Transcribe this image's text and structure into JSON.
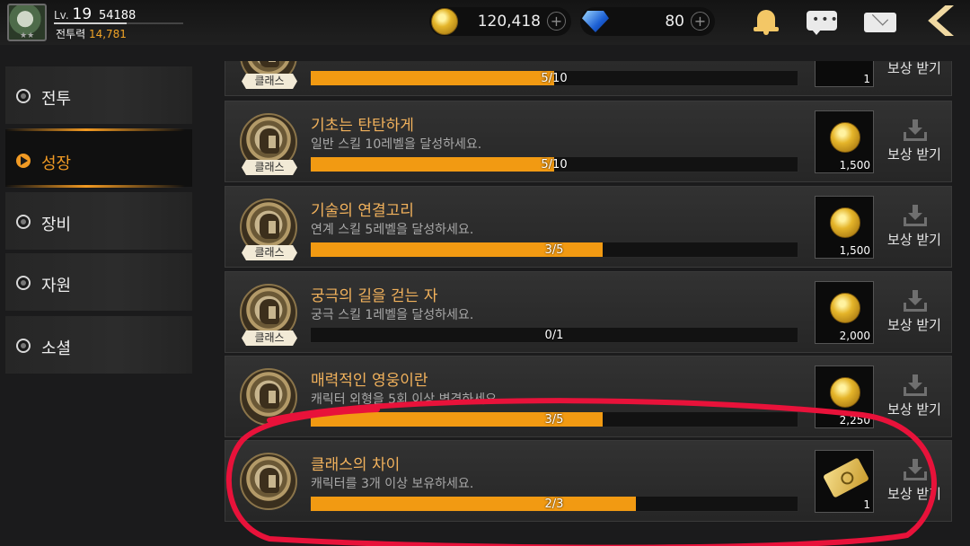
{
  "player": {
    "level_label": "Lv.",
    "level": "19",
    "exp": "54188",
    "power_label": "전투력",
    "power": "14,781",
    "stars": "★★"
  },
  "currency": {
    "gold": "120,418",
    "gems": "80",
    "plus": "+"
  },
  "top_icons": [
    "bell-icon",
    "chat-icon",
    "mail-icon",
    "back-arrow-icon"
  ],
  "sidebar": {
    "items": [
      {
        "label": "전투",
        "active": false
      },
      {
        "label": "성장",
        "active": true
      },
      {
        "label": "장비",
        "active": false
      },
      {
        "label": "자원",
        "active": false
      },
      {
        "label": "소셜",
        "active": false
      }
    ]
  },
  "quests": [
    {
      "title": "",
      "desc": "",
      "tag": "클래스",
      "progress": "5/10",
      "fraction": 0.5,
      "reward_qty": "1",
      "reward_type": "item",
      "claim": "보상 받기"
    },
    {
      "title": "기초는 탄탄하게",
      "desc": "일반 스킬 10레벨을 달성하세요.",
      "tag": "클래스",
      "progress": "5/10",
      "fraction": 0.5,
      "reward_qty": "1,500",
      "reward_type": "gold",
      "claim": "보상 받기"
    },
    {
      "title": "기술의 연결고리",
      "desc": "연계 스킬 5레벨을 달성하세요.",
      "tag": "클래스",
      "progress": "3/5",
      "fraction": 0.6,
      "reward_qty": "1,500",
      "reward_type": "gold",
      "claim": "보상 받기"
    },
    {
      "title": "궁극의 길을 걷는 자",
      "desc": "궁극 스킬 1레벨을 달성하세요.",
      "tag": "클래스",
      "progress": "0/1",
      "fraction": 0.0,
      "reward_qty": "2,000",
      "reward_type": "gold",
      "claim": "보상 받기"
    },
    {
      "title": "매력적인 영웅이란",
      "desc": "캐릭터 외형을 5회 이상 변경하세요.",
      "tag": "",
      "progress": "3/5",
      "fraction": 0.6,
      "reward_qty": "2,250",
      "reward_type": "gold",
      "claim": "보상 받기"
    },
    {
      "title": "클래스의 차이",
      "desc": "캐릭터를 3개 이상 보유하세요.",
      "tag": "",
      "progress": "2/3",
      "fraction": 0.667,
      "reward_qty": "1",
      "reward_type": "ticket",
      "claim": "보상 받기"
    }
  ],
  "colors": {
    "accent": "#f29a12",
    "title": "#f2b25c",
    "annotation": "#e8123a"
  }
}
